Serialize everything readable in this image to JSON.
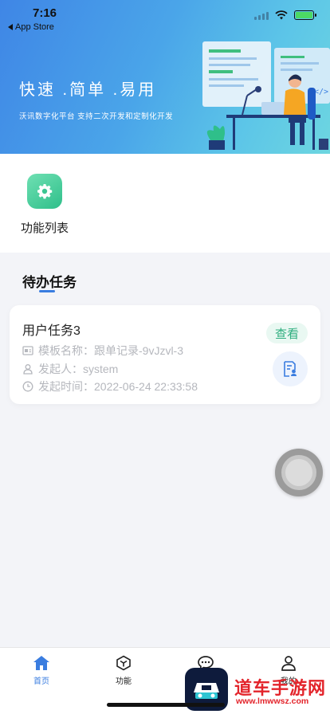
{
  "status_bar": {
    "time": "7:16",
    "back_label": "App Store"
  },
  "banner": {
    "slogan": "快速 .简单 .易用",
    "subtitle": "沃讯数字化平台 支持二次开发和定制化开发"
  },
  "functions": [
    {
      "label": "功能列表",
      "icon": "gear-icon"
    }
  ],
  "todo": {
    "title": "待办任务",
    "tasks": [
      {
        "name": "用户任务3",
        "template": "模板名称：跟单记录-9vJzvl-3",
        "initiator": "发起人：system",
        "time": "发起时间：2022-06-24 22:33:58",
        "action_label": "查看"
      }
    ]
  },
  "tab_bar": {
    "items": [
      {
        "label": "首页",
        "icon": "home-icon",
        "active": true
      },
      {
        "label": "功能",
        "icon": "cube-icon",
        "active": false
      },
      {
        "label": "",
        "icon": "chat-icon",
        "active": false
      },
      {
        "label": "我的",
        "icon": "user-icon",
        "active": false
      }
    ]
  },
  "watermark": {
    "text": "道车手游网",
    "url": "www.lmwwsz.com"
  },
  "colors": {
    "accent": "#3a7de0",
    "green": "#2fae7f",
    "banner_start": "#3f86e6",
    "banner_end": "#6dd6e0"
  }
}
